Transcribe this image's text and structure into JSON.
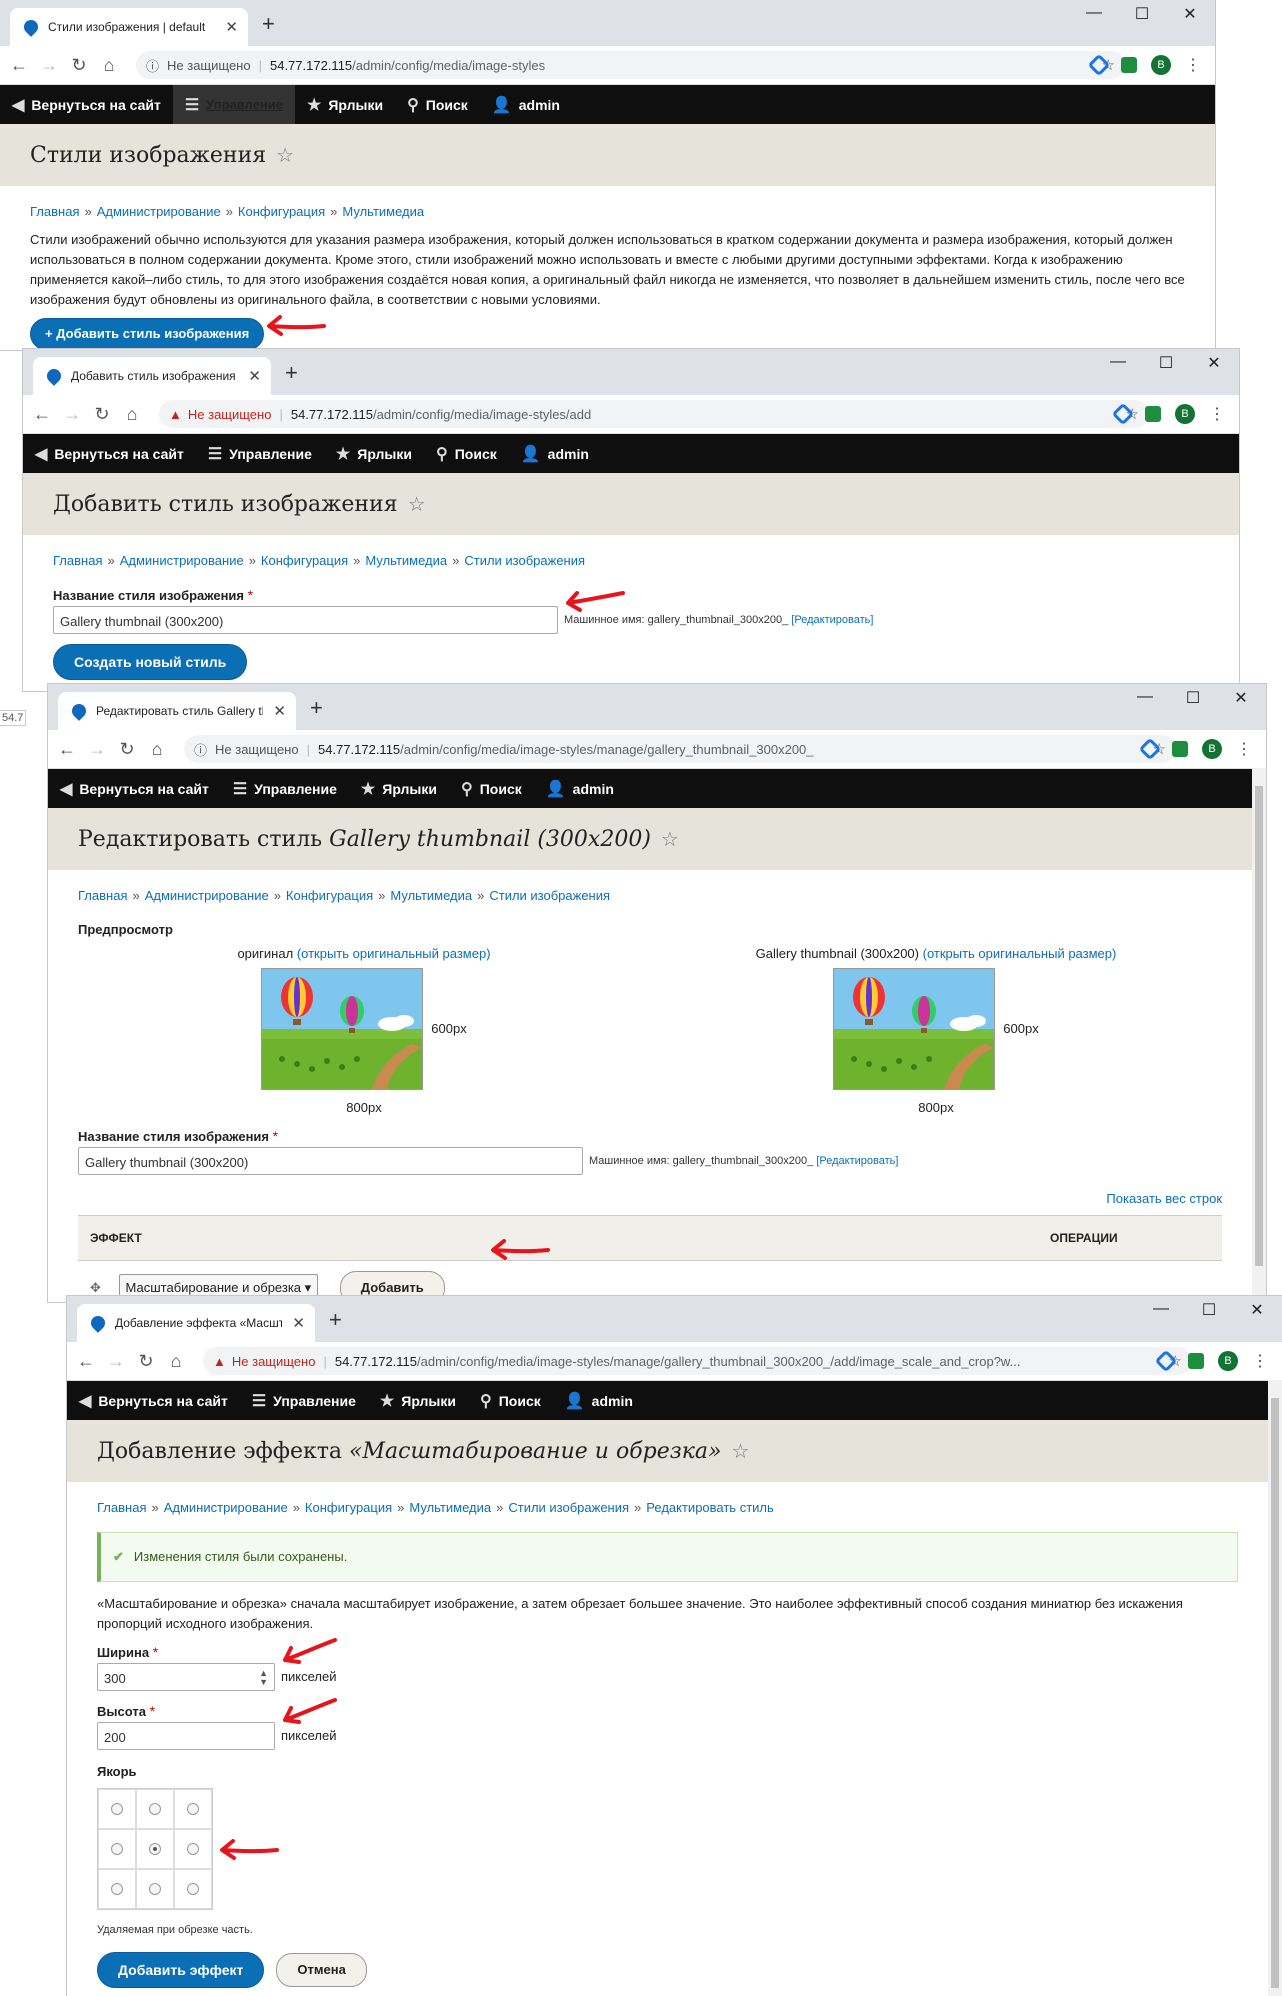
{
  "toolbar": {
    "back_to_site": "Вернуться на сайт",
    "manage": "Управление",
    "shortcuts": "Ярлыки",
    "search": "Поиск",
    "user": "admin"
  },
  "breadcrumbs": {
    "home": "Главная",
    "admin": "Администрирование",
    "config": "Конфигурация",
    "media": "Мультимедиа",
    "image_styles": "Стили изображения",
    "edit_style": "Редактировать стиль"
  },
  "side_fragment": "54.7",
  "win1": {
    "tab_title": "Стили изображения | default",
    "security": "Не защищено",
    "url_host": "54.77.172.115",
    "url_path": "/admin/config/media/image-styles",
    "page_title": "Стили изображения",
    "description": "Стили изображений обычно используются для указания размера изображения, который должен использоваться в кратком содержании документа и размера изображения, который должен использоваться в полном содержании документа. Кроме этого, стили изображений можно использовать и вместе с любыми другими доступными эффектами. Когда к изображению применяется какой–либо стиль, то для этого изображения создаётся новая копия, а оригинальный файл никогда не изменяется, что позволяет в дальнейшем изменить стиль, после чего все изображения будут обновлены из оригинального файла, в соответствии с новыми условиями.",
    "add_button": "+ Добавить стиль изображения"
  },
  "win2": {
    "tab_title": "Добавить стиль изображения | ",
    "security": "Не защищено",
    "url_host": "54.77.172.115",
    "url_path": "/admin/config/media/image-styles/add",
    "page_title": "Добавить стиль изображения",
    "name_label": "Название стиля изображения",
    "name_value": "Gallery thumbnail (300x200)",
    "machine_name": "Машинное имя: gallery_thumbnail_300x200_",
    "edit_link": "[Редактировать]",
    "create_button": "Создать новый стиль"
  },
  "win3": {
    "tab_title": "Редактировать стиль Gallery thu",
    "security": "Не защищено",
    "url_host": "54.77.172.115",
    "url_path": "/admin/config/media/image-styles/manage/gallery_thumbnail_300x200_",
    "page_title_prefix": "Редактировать стиль",
    "page_title_style": "Gallery thumbnail (300x200)",
    "preview_label": "Предпросмотр",
    "original_label": "оригинал",
    "open_original": "(открыть оригинальный размер)",
    "thumb_label": "Gallery thumbnail (300x200)",
    "height_px": "600px",
    "width_px": "800px",
    "name_label": "Название стиля изображения",
    "name_value": "Gallery thumbnail (300x200)",
    "machine_name": "Машинное имя: gallery_thumbnail_300x200_",
    "edit_link": "[Редактировать]",
    "show_weights": "Показать вес строк",
    "col_effect": "Эффект",
    "col_ops": "Операции",
    "effect_select": "Масштабирование и обрезка",
    "add_button": "Добавить"
  },
  "win4": {
    "tab_title": "Добавление эффекта «Масштаб",
    "security": "Не защищено",
    "url_host": "54.77.172.115",
    "url_path": "/admin/config/media/image-styles/manage/gallery_thumbnail_300x200_/add/image_scale_and_crop?w...",
    "page_title_prefix": "Добавление эффекта",
    "page_title_effect": "«Масштабирование и обрезка»",
    "status_msg": "Изменения стиля были сохранены.",
    "description": "«Масштабирование и обрезка» сначала масштабирует изображение, а затем обрезает большее значение. Это наиболее эффективный способ создания миниатюр без искажения пропорций исходного изображения.",
    "width_label": "Ширина",
    "width_value": "300",
    "height_label": "Высота",
    "height_value": "200",
    "unit": "пикселей",
    "anchor_label": "Якорь",
    "anchor_selected": "center-center",
    "anchor_help": "Удаляемая при обрезке часть.",
    "submit": "Добавить эффект",
    "cancel": "Отмена"
  },
  "chrome": {
    "avatar_letter": "B",
    "win_min": "—",
    "win_max": "☐",
    "win_close": "✕",
    "new_tab": "+",
    "tab_close": "✕"
  },
  "colors": {
    "link": "#0b6fb5",
    "toolbar": "#0f0f0f",
    "header": "#e5e3da",
    "arrow": "#e8141b",
    "success": "#77b259"
  }
}
